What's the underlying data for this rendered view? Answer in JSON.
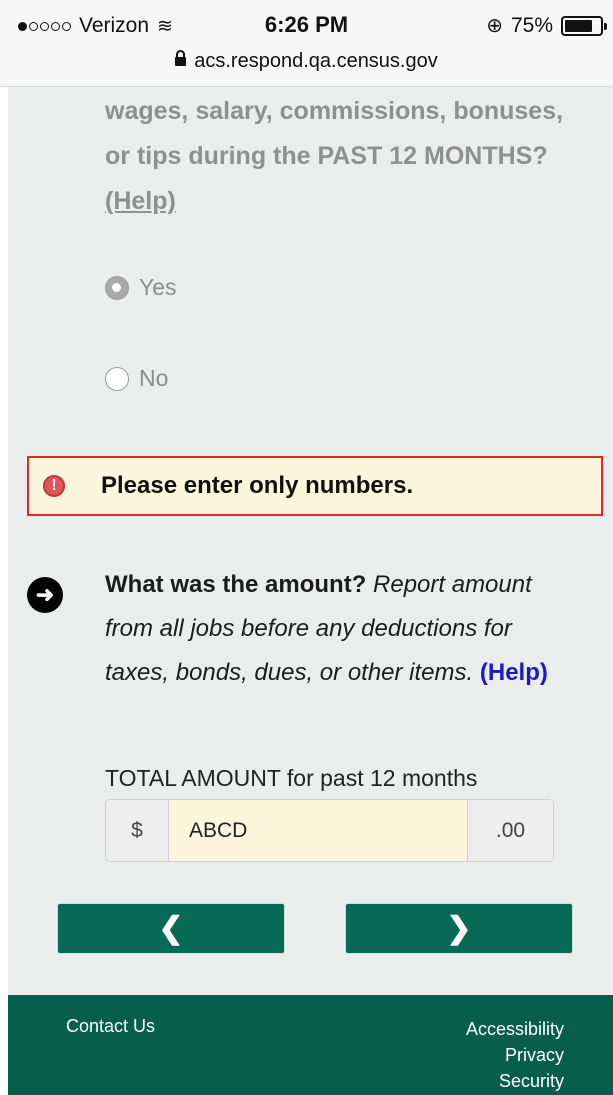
{
  "status_bar": {
    "carrier": "Verizon",
    "signal_filled_dots": 1,
    "signal_total_dots": 5,
    "time": "6:26 PM",
    "battery_percent": "75%",
    "battery_level": 0.75,
    "url": "acs.respond.qa.census.gov"
  },
  "question": {
    "text": "wages, salary, commissions, bonuses, or tips during the PAST 12 MONTHS?",
    "help_label": "(Help)",
    "options": [
      {
        "label": "Yes",
        "selected": true
      },
      {
        "label": "No",
        "selected": false
      }
    ]
  },
  "error": {
    "icon": "exclamation-icon",
    "message": "Please enter only numbers."
  },
  "amount_question": {
    "icon": "arrow-right-circle-icon",
    "bold_text": "What was the amount?",
    "italic_text": "Report amount from all jobs before any deductions for taxes, bonds, dues, or other items.",
    "help_label": "(Help)"
  },
  "amount_field": {
    "label": "TOTAL AMOUNT for past 12 months",
    "prefix": "$",
    "value": "ABCD",
    "suffix": ".00"
  },
  "navigation": {
    "prev_icon": "chevron-left-icon",
    "next_icon": "chevron-right-icon",
    "prev_glyph": "❮",
    "next_glyph": "❯"
  },
  "footer": {
    "contact": "Contact Us",
    "links": [
      "Accessibility",
      "Privacy",
      "Security"
    ]
  },
  "colors": {
    "content_bg": "#e9eeec",
    "error_border": "#e0262e",
    "error_bg": "#fcf6dc",
    "nav_button": "#076a57",
    "footer_bg": "#075e4d",
    "help_link": "#1a1ac8"
  }
}
